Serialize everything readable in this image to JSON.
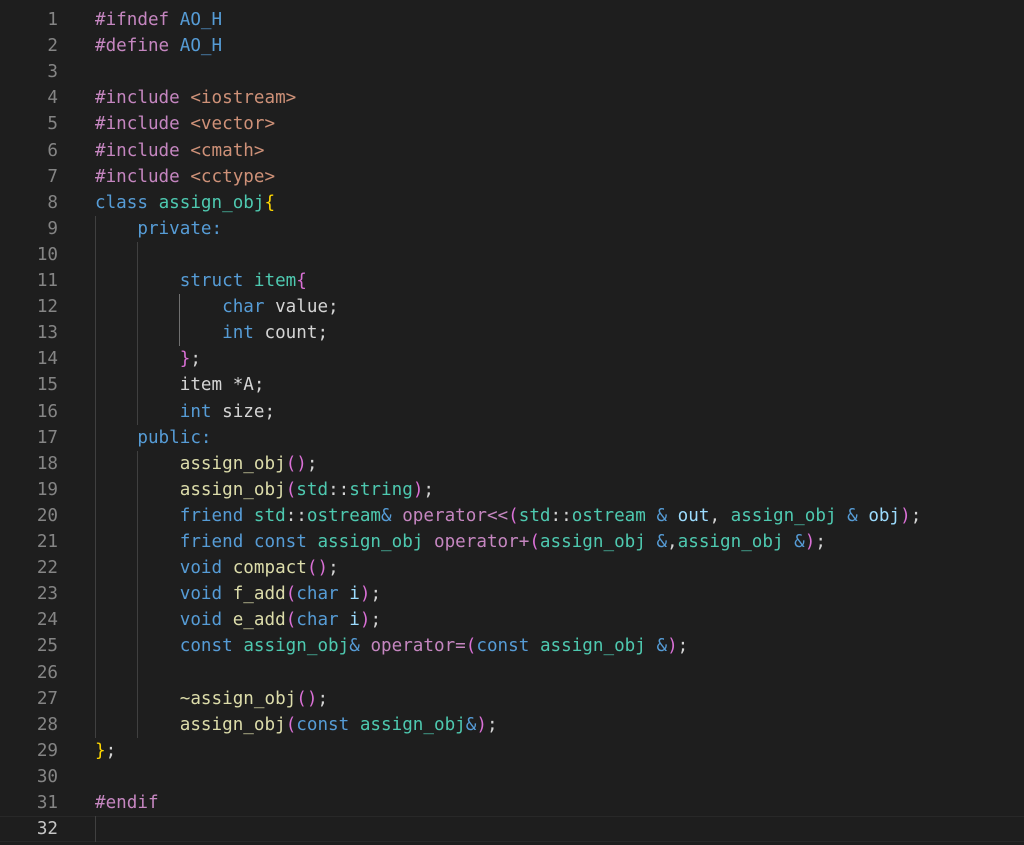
{
  "editor": {
    "language": "cpp",
    "current_line": 32,
    "token_colors": {
      "pp": "#c586c0",
      "str": "#ce9178",
      "kw": "#569cd6",
      "kw2": "#c586c0",
      "type": "#4ec9b0",
      "fn": "#dcdcaa",
      "var": "#9cdcfe",
      "def": "#d4d4d4",
      "b1": "#ffd700",
      "b2": "#da70d6",
      "b3": "#179fff"
    },
    "lines": [
      {
        "num": "1",
        "tokens": [
          {
            "c": "pp",
            "t": "#ifndef "
          },
          {
            "c": "kw",
            "t": "AO_H"
          }
        ]
      },
      {
        "num": "2",
        "tokens": [
          {
            "c": "pp",
            "t": "#define "
          },
          {
            "c": "kw",
            "t": "AO_H"
          }
        ]
      },
      {
        "num": "3",
        "tokens": []
      },
      {
        "num": "4",
        "tokens": [
          {
            "c": "pp",
            "t": "#include "
          },
          {
            "c": "str",
            "t": "<iostream>"
          }
        ]
      },
      {
        "num": "5",
        "tokens": [
          {
            "c": "pp",
            "t": "#include "
          },
          {
            "c": "str",
            "t": "<vector>"
          }
        ]
      },
      {
        "num": "6",
        "tokens": [
          {
            "c": "pp",
            "t": "#include "
          },
          {
            "c": "str",
            "t": "<cmath>"
          }
        ]
      },
      {
        "num": "7",
        "tokens": [
          {
            "c": "pp",
            "t": "#include "
          },
          {
            "c": "str",
            "t": "<cctype>"
          }
        ]
      },
      {
        "num": "8",
        "tokens": [
          {
            "c": "kw",
            "t": "class "
          },
          {
            "c": "type",
            "t": "assign_obj"
          },
          {
            "c": "b1",
            "t": "{"
          }
        ]
      },
      {
        "num": "9",
        "tokens": [
          {
            "c": "def",
            "t": "    "
          },
          {
            "c": "kw",
            "t": "private:"
          }
        ]
      },
      {
        "num": "10",
        "tokens": []
      },
      {
        "num": "11",
        "tokens": [
          {
            "c": "def",
            "t": "        "
          },
          {
            "c": "kw",
            "t": "struct "
          },
          {
            "c": "type",
            "t": "item"
          },
          {
            "c": "b2",
            "t": "{"
          }
        ]
      },
      {
        "num": "12",
        "tokens": [
          {
            "c": "def",
            "t": "            "
          },
          {
            "c": "kw",
            "t": "char "
          },
          {
            "c": "def",
            "t": "value;"
          }
        ]
      },
      {
        "num": "13",
        "tokens": [
          {
            "c": "def",
            "t": "            "
          },
          {
            "c": "kw",
            "t": "int "
          },
          {
            "c": "def",
            "t": "count;"
          }
        ]
      },
      {
        "num": "14",
        "tokens": [
          {
            "c": "def",
            "t": "        "
          },
          {
            "c": "b2",
            "t": "}"
          },
          {
            "c": "def",
            "t": ";"
          }
        ]
      },
      {
        "num": "15",
        "tokens": [
          {
            "c": "def",
            "t": "        item *A;"
          }
        ]
      },
      {
        "num": "16",
        "tokens": [
          {
            "c": "def",
            "t": "        "
          },
          {
            "c": "kw",
            "t": "int "
          },
          {
            "c": "def",
            "t": "size;"
          }
        ]
      },
      {
        "num": "17",
        "tokens": [
          {
            "c": "def",
            "t": "    "
          },
          {
            "c": "kw",
            "t": "public:"
          }
        ]
      },
      {
        "num": "18",
        "tokens": [
          {
            "c": "def",
            "t": "        "
          },
          {
            "c": "fn",
            "t": "assign_obj"
          },
          {
            "c": "b2",
            "t": "()"
          },
          {
            "c": "def",
            "t": ";"
          }
        ]
      },
      {
        "num": "19",
        "tokens": [
          {
            "c": "def",
            "t": "        "
          },
          {
            "c": "fn",
            "t": "assign_obj"
          },
          {
            "c": "b2",
            "t": "("
          },
          {
            "c": "type",
            "t": "std"
          },
          {
            "c": "def",
            "t": "::"
          },
          {
            "c": "type",
            "t": "string"
          },
          {
            "c": "b2",
            "t": ")"
          },
          {
            "c": "def",
            "t": ";"
          }
        ]
      },
      {
        "num": "20",
        "tokens": [
          {
            "c": "def",
            "t": "        "
          },
          {
            "c": "kw",
            "t": "friend "
          },
          {
            "c": "type",
            "t": "std"
          },
          {
            "c": "def",
            "t": "::"
          },
          {
            "c": "type",
            "t": "ostream"
          },
          {
            "c": "kw",
            "t": "& "
          },
          {
            "c": "kw2",
            "t": "operator<<"
          },
          {
            "c": "b2",
            "t": "("
          },
          {
            "c": "type",
            "t": "std"
          },
          {
            "c": "def",
            "t": "::"
          },
          {
            "c": "type",
            "t": "ostream "
          },
          {
            "c": "kw",
            "t": "& "
          },
          {
            "c": "var",
            "t": "out"
          },
          {
            "c": "def",
            "t": ", "
          },
          {
            "c": "type",
            "t": "assign_obj "
          },
          {
            "c": "kw",
            "t": "& "
          },
          {
            "c": "var",
            "t": "obj"
          },
          {
            "c": "b2",
            "t": ")"
          },
          {
            "c": "def",
            "t": ";"
          }
        ]
      },
      {
        "num": "21",
        "tokens": [
          {
            "c": "def",
            "t": "        "
          },
          {
            "c": "kw",
            "t": "friend const "
          },
          {
            "c": "type",
            "t": "assign_obj "
          },
          {
            "c": "kw2",
            "t": "operator+"
          },
          {
            "c": "b2",
            "t": "("
          },
          {
            "c": "type",
            "t": "assign_obj "
          },
          {
            "c": "kw",
            "t": "&"
          },
          {
            "c": "def",
            "t": ","
          },
          {
            "c": "type",
            "t": "assign_obj "
          },
          {
            "c": "kw",
            "t": "&"
          },
          {
            "c": "b2",
            "t": ")"
          },
          {
            "c": "def",
            "t": ";"
          }
        ]
      },
      {
        "num": "22",
        "tokens": [
          {
            "c": "def",
            "t": "        "
          },
          {
            "c": "kw",
            "t": "void "
          },
          {
            "c": "fn",
            "t": "compact"
          },
          {
            "c": "b2",
            "t": "()"
          },
          {
            "c": "def",
            "t": ";"
          }
        ]
      },
      {
        "num": "23",
        "tokens": [
          {
            "c": "def",
            "t": "        "
          },
          {
            "c": "kw",
            "t": "void "
          },
          {
            "c": "fn",
            "t": "f_add"
          },
          {
            "c": "b2",
            "t": "("
          },
          {
            "c": "kw",
            "t": "char "
          },
          {
            "c": "var",
            "t": "i"
          },
          {
            "c": "b2",
            "t": ")"
          },
          {
            "c": "def",
            "t": ";"
          }
        ]
      },
      {
        "num": "24",
        "tokens": [
          {
            "c": "def",
            "t": "        "
          },
          {
            "c": "kw",
            "t": "void "
          },
          {
            "c": "fn",
            "t": "e_add"
          },
          {
            "c": "b2",
            "t": "("
          },
          {
            "c": "kw",
            "t": "char "
          },
          {
            "c": "var",
            "t": "i"
          },
          {
            "c": "b2",
            "t": ")"
          },
          {
            "c": "def",
            "t": ";"
          }
        ]
      },
      {
        "num": "25",
        "tokens": [
          {
            "c": "def",
            "t": "        "
          },
          {
            "c": "kw",
            "t": "const "
          },
          {
            "c": "type",
            "t": "assign_obj"
          },
          {
            "c": "kw",
            "t": "& "
          },
          {
            "c": "kw2",
            "t": "operator="
          },
          {
            "c": "b2",
            "t": "("
          },
          {
            "c": "kw",
            "t": "const "
          },
          {
            "c": "type",
            "t": "assign_obj "
          },
          {
            "c": "kw",
            "t": "&"
          },
          {
            "c": "b2",
            "t": ")"
          },
          {
            "c": "def",
            "t": ";"
          }
        ]
      },
      {
        "num": "26",
        "tokens": []
      },
      {
        "num": "27",
        "tokens": [
          {
            "c": "def",
            "t": "        "
          },
          {
            "c": "fn",
            "t": "~assign_obj"
          },
          {
            "c": "b2",
            "t": "()"
          },
          {
            "c": "def",
            "t": ";"
          }
        ]
      },
      {
        "num": "28",
        "tokens": [
          {
            "c": "def",
            "t": "        "
          },
          {
            "c": "fn",
            "t": "assign_obj"
          },
          {
            "c": "b2",
            "t": "("
          },
          {
            "c": "kw",
            "t": "const "
          },
          {
            "c": "type",
            "t": "assign_obj"
          },
          {
            "c": "kw",
            "t": "&"
          },
          {
            "c": "b2",
            "t": ")"
          },
          {
            "c": "def",
            "t": ";"
          }
        ]
      },
      {
        "num": "29",
        "tokens": [
          {
            "c": "b1",
            "t": "}"
          },
          {
            "c": "def",
            "t": ";"
          }
        ]
      },
      {
        "num": "30",
        "tokens": []
      },
      {
        "num": "31",
        "tokens": [
          {
            "c": "pp",
            "t": "#endif"
          }
        ]
      },
      {
        "num": "32",
        "tokens": []
      }
    ]
  }
}
